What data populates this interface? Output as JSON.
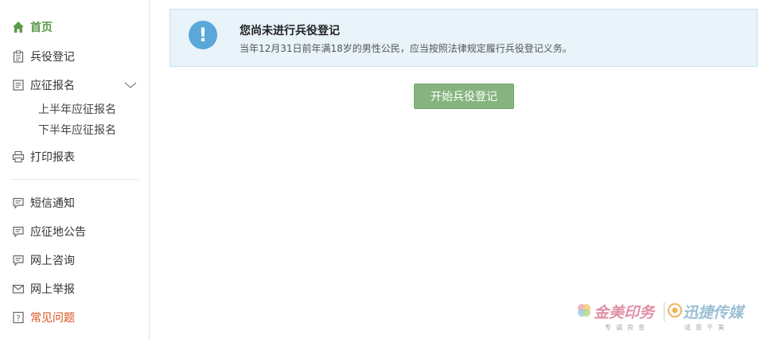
{
  "sidebar": {
    "items": [
      {
        "label": "首页",
        "icon": "home-icon"
      },
      {
        "label": "兵役登记",
        "icon": "clipboard-icon"
      },
      {
        "label": "应征报名",
        "icon": "form-icon"
      },
      {
        "label": "打印报表",
        "icon": "printer-icon"
      },
      {
        "label": "短信通知",
        "icon": "message-icon"
      },
      {
        "label": "应征地公告",
        "icon": "message-icon"
      },
      {
        "label": "网上咨询",
        "icon": "message-icon"
      },
      {
        "label": "网上举报",
        "icon": "mail-icon"
      },
      {
        "label": "常见问题",
        "icon": "question-icon"
      }
    ],
    "submenu": [
      "上半年应征报名",
      "下半年应征报名"
    ]
  },
  "notice": {
    "title": "您尚未进行兵役登记",
    "desc": "当年12月31日前年满18岁的男性公民，应当按照法律规定履行兵役登记义务。"
  },
  "actions": {
    "start_label": "开始兵役登记"
  },
  "watermark": {
    "brand_a": "金美印务",
    "brand_b": "迅捷传媒",
    "sub_a": "专诚良金",
    "sub_b": "适意千美"
  },
  "colors": {
    "accent_green": "#5b9a4a",
    "button_green": "#86b47f",
    "notice_bg": "#e8f3fa",
    "info_blue": "#5aa7d9",
    "faq_orange": "#d9531e"
  }
}
